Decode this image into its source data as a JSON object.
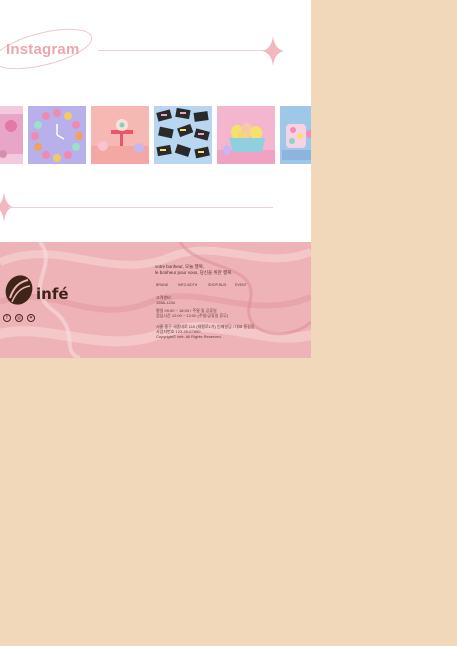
{
  "section": {
    "title": "Instagram"
  },
  "gallery": {
    "photos": [
      {
        "name": "pink-sweets-photo",
        "bg": "#f3c9de",
        "accent": "#e27aa3"
      },
      {
        "name": "donut-clock-photo",
        "bg": "#b7b0ea",
        "accent": "#f08ab0"
      },
      {
        "name": "macaron-stand-photo",
        "bg": "#f6b8b3",
        "accent": "#7fd1c3"
      },
      {
        "name": "chocolate-bars-photo",
        "bg": "#b8d6ef",
        "accent": "#2a2a2a"
      },
      {
        "name": "egg-basket-photo",
        "bg": "#f4b6cf",
        "accent": "#f6e26a"
      },
      {
        "name": "candy-jars-photo",
        "bg": "#9fc7e8",
        "accent": "#f08fb0"
      }
    ]
  },
  "footer": {
    "logo_text": "infé",
    "tagline_1": "votre bonheur, 오늘 행복,",
    "tagline_2": "le bonheur pour vous, 당신을 위한 행복.",
    "nav": [
      "BRAND",
      "INFO-BOTH",
      "SHOP-BUS",
      "EVENT"
    ],
    "contact_1": "고객센터",
    "contact_2": "1588-1234",
    "hours_1": "평일 09:00 ~ 18:00 / 주말 및 공휴일",
    "hours_2": "점심시간 12:00 ~ 13:00 (주말/공휴일 휴무)",
    "address_1": "서울 중구 세종대로 110 (태평로1가) 인페빌딩 / 대표 홍길동",
    "address_2": "사업자번호 123-45-67890",
    "copyright": "Copyright© infé. All Rights Reserved.",
    "social_icons": [
      "facebook-icon",
      "instagram-icon",
      "twitter-icon"
    ],
    "colors": {
      "footer_bg": "#eeb3b6",
      "logo": "#3f2418"
    }
  },
  "colors": {
    "outer_bg": "#f1d8bb",
    "accent_pink": "#eaa7ae"
  }
}
